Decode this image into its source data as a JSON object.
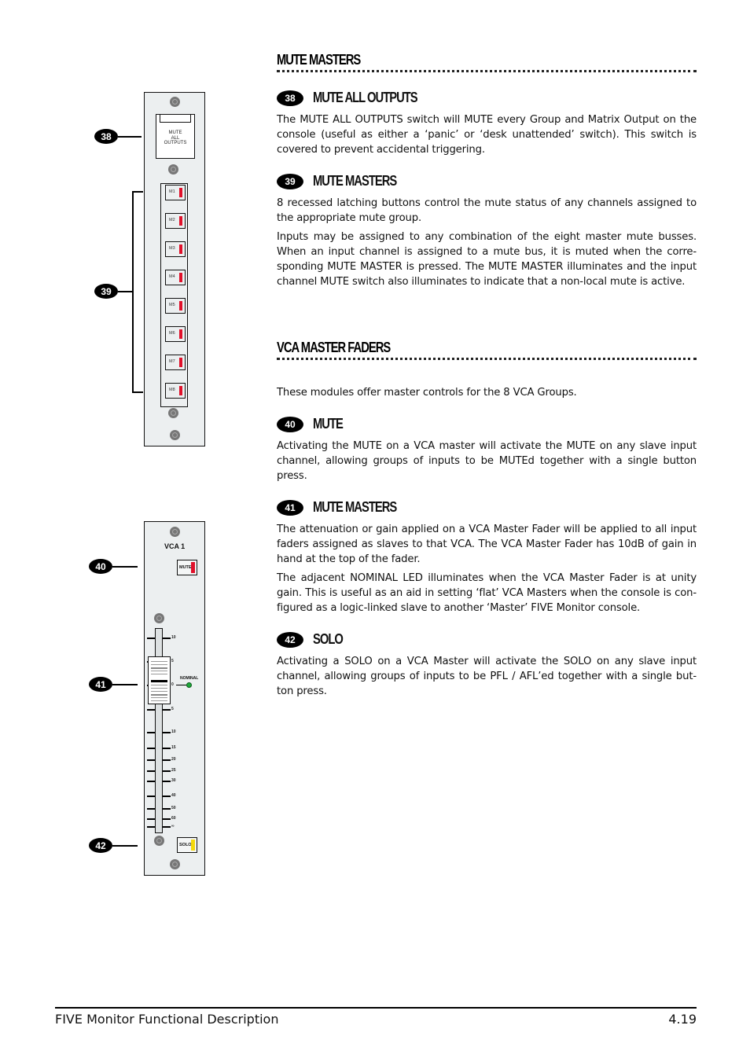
{
  "sections": {
    "mute_masters": {
      "title": "MUTE MASTERS",
      "items": [
        {
          "number": "38",
          "title": "MUTE ALL OUTPUTS",
          "paragraphs": [
            "The MUTE ALL OUTPUTS switch will MUTE every Group and Matrix Output on the console (useful as either a ‘panic’ or ‘desk unattended’ switch). This switch is covered to prevent accidental triggering."
          ]
        },
        {
          "number": "39",
          "title": "MUTE MASTERS",
          "paragraphs": [
            "8 recessed latching buttons control the mute status of any channels assigned to the appropriate mute group.",
            "Inputs may be assigned to any combination of the eight master mute busses. When an input channel is assigned to a mute bus, it is muted when the corre-sponding MUTE MASTER is pressed. The MUTE MASTER illuminates and the input channel MUTE switch also illuminates to indicate that a non-local mute is active."
          ]
        }
      ]
    },
    "vca_master_faders": {
      "title": "VCA MASTER FADERS",
      "intro": "These modules offer master controls for the 8 VCA Groups.",
      "items": [
        {
          "number": "40",
          "title": "MUTE",
          "paragraphs": [
            "Activating the MUTE on a VCA master will activate the MUTE on any slave input channel, allowing groups of inputs to be MUTEd together with a single button press."
          ]
        },
        {
          "number": "41",
          "title": "MUTE MASTERS",
          "paragraphs": [
            "The attenuation or gain applied on a VCA Master Fader will be applied to all input faders assigned as slaves to that VCA.  The VCA Master Fader has 10dB of gain in hand at the top of the fader.",
            "The adjacent NOMINAL LED illuminates when the VCA Master Fader is at unity gain. This is useful as an aid in setting ‘flat’ VCA Masters when the console is con-figured as a logic-linked slave to another ‘Master’ FIVE Monitor console."
          ]
        },
        {
          "number": "42",
          "title": "SOLO",
          "paragraphs": [
            "Activating a SOLO on a VCA Master will activate the SOLO on any slave input channel, allowing groups of inputs to be PFL / AFL’ed together with a single but-ton press."
          ]
        }
      ]
    }
  },
  "diagrams": {
    "mute_panel": {
      "callouts": [
        "38",
        "39"
      ],
      "cover_label": [
        "MUTE",
        "ALL",
        "OUTPUTS"
      ],
      "buttons": [
        "M1",
        "M2",
        "M3",
        "M4",
        "M5",
        "M6",
        "M7",
        "M8"
      ],
      "led_color": "#e0102a"
    },
    "vca_panel": {
      "callouts": [
        "40",
        "41",
        "42"
      ],
      "title": "VCA 1",
      "mute_label": "MUTE",
      "mute_led_color": "#e0102a",
      "solo_label": "SOLO",
      "solo_led_color": "#f5d90a",
      "nominal_label": "NOMINAL",
      "nominal_led_color": "#1ea83a",
      "scale": [
        "10",
        "5",
        "0",
        "5",
        "10",
        "15",
        "20",
        "25",
        "30",
        "40",
        "50",
        "60",
        "∞"
      ],
      "fader_position_db": 0
    }
  },
  "footer": {
    "title": "FIVE Monitor Functional Description",
    "page": "4.19"
  }
}
